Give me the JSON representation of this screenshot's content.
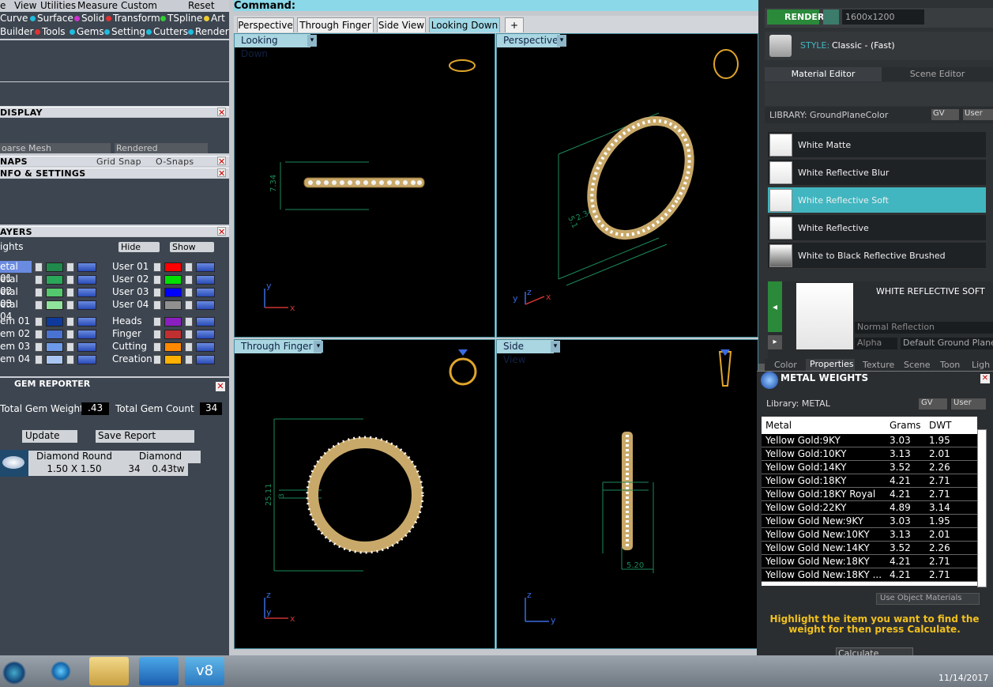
{
  "menu": {
    "items": [
      "e",
      "View",
      "Utilities",
      "Measure",
      "Custom",
      "Reset"
    ]
  },
  "submenu1": {
    "items": [
      "Curve",
      "Surface",
      "Solid",
      "Transform",
      "TSpline",
      "Art"
    ]
  },
  "submenu2": {
    "items": [
      "Builder",
      "Tools",
      "Gems",
      "Setting",
      "Cutters",
      "Render"
    ]
  },
  "display": {
    "title": "DISPLAY",
    "mesh": "oarse Mesh",
    "mode": "Rendered"
  },
  "snaps": {
    "title": "NAPS",
    "grid": "Grid Snap",
    "osnaps": "O-Snaps"
  },
  "info": {
    "title": "NFO & SETTINGS"
  },
  "layers": {
    "title": "AYERS",
    "lights": "ights",
    "hide": "Hide",
    "show": "Show",
    "left": [
      "etal 01",
      "etal 02",
      "etal 03",
      "etal 04",
      "em 01",
      "em 02",
      "em 03",
      "em 04"
    ],
    "right": [
      "User 01",
      "User 02",
      "User 03",
      "User 04",
      "Heads",
      "Finger",
      "Cutting",
      "Creation"
    ],
    "left_colors": [
      "#1f8a4c",
      "#2aa85a",
      "#53c86e",
      "#8fe39a",
      "#0e3a9c",
      "#4a72d0",
      "#6d9ae8",
      "#a9c6f3"
    ],
    "right_colors": [
      "#ff0000",
      "#00e000",
      "#0000ff",
      "#909090",
      "#8a1fc0",
      "#c03030",
      "#ff8800",
      "#ffb000"
    ]
  },
  "gem_reporter": {
    "title": "GEM REPORTER",
    "total_weight_label": "Total Gem Weight",
    "total_weight": ".43",
    "total_count_label": "Total Gem Count",
    "total_count": "34",
    "update": "Update",
    "save": "Save Report",
    "col1": "Diamond Round",
    "col2": "Diamond",
    "size": "1.50 X 1.50",
    "count": "34",
    "tw": "0.43tw"
  },
  "command": {
    "label": "Command:"
  },
  "view_tabs": [
    {
      "label": "Perspective"
    },
    {
      "label": "Through Finger"
    },
    {
      "label": "Side View"
    },
    {
      "label": "Looking Down"
    }
  ],
  "viewports": {
    "tl": {
      "label": "Looking Down",
      "dim": "7.34"
    },
    "tr": {
      "label": "Perspective",
      "dim1": "2.34",
      "dim2": "5.1"
    },
    "bl": {
      "label": "Through Finger",
      "dim": "25.11",
      "dim2": "3"
    },
    "br": {
      "label": "Side View",
      "dim": "5.20"
    }
  },
  "render_bar": {
    "render": "RENDER",
    "resolution": "1600x1200",
    "style_label": "STYLE:",
    "style_value": "Classic - (Fast)"
  },
  "material_editor": {
    "tab1": "Material Editor",
    "tab2": "Scene Editor",
    "library": "LIBRARY: GroundPlaneColor",
    "gv": "GV",
    "user": "User",
    "items": [
      "White Matte",
      "White Reflective Blur",
      "White Reflective Soft",
      "White Reflective",
      "White to Black Reflective Brushed"
    ],
    "selected_title": "WHITE REFLECTIVE SOFT",
    "reflection": "Normal Reflection",
    "alpha": "Alpha",
    "ground": "Default Ground Plane",
    "bottom_tabs": [
      "Color",
      "Properties",
      "Texture",
      "Scene",
      "Toon",
      "Ligh"
    ]
  },
  "metal_weights": {
    "title": "METAL WEIGHTS",
    "library": "Library: METAL",
    "gv": "GV",
    "user": "User",
    "headers": [
      "Metal",
      "Grams",
      "DWT"
    ],
    "rows": [
      [
        "Yellow Gold:9KY",
        "3.03",
        "1.95"
      ],
      [
        "Yellow Gold:10KY",
        "3.13",
        "2.01"
      ],
      [
        "Yellow Gold:14KY",
        "3.52",
        "2.26"
      ],
      [
        "Yellow Gold:18KY",
        "4.21",
        "2.71"
      ],
      [
        "Yellow Gold:18KY Royal",
        "4.21",
        "2.71"
      ],
      [
        "Yellow Gold:22KY",
        "4.89",
        "3.14"
      ],
      [
        "Yellow Gold New:9KY",
        "3.03",
        "1.95"
      ],
      [
        "Yellow Gold New:10KY",
        "3.13",
        "2.01"
      ],
      [
        "Yellow Gold New:14KY",
        "3.52",
        "2.26"
      ],
      [
        "Yellow Gold New:18KY",
        "4.21",
        "2.71"
      ],
      [
        "Yellow Gold New:18KY ...",
        "4.21",
        "2.71"
      ]
    ],
    "use_object": "Use Object Materials",
    "hint": "Highlight the item you want to find the weight for then press Calculate.",
    "calculate": "Calculate"
  },
  "taskbar": {
    "date": "11/14/2017"
  }
}
